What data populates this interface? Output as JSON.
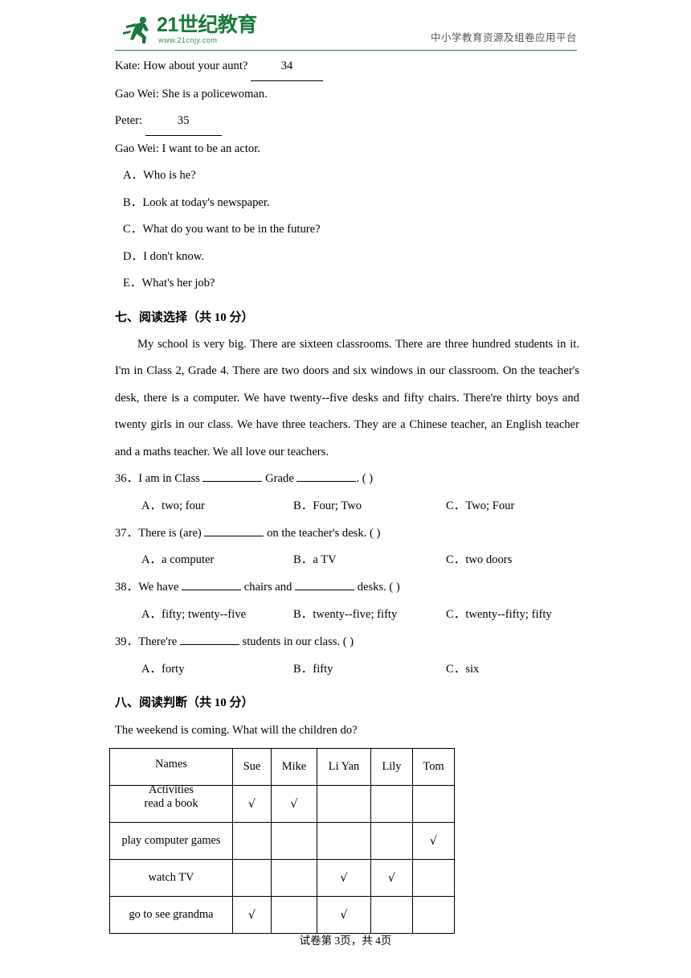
{
  "header": {
    "logo_text": "21世纪教育",
    "logo_url": "www.21cnjy.com",
    "slogan": "中小学教育资源及组卷应用平台"
  },
  "dialogue": {
    "lines": [
      {
        "speaker": "Kate: How about your aunt?",
        "blank": "34"
      },
      {
        "speaker": "Gao Wei: She is a policewoman.",
        "blank": ""
      },
      {
        "speaker": "Peter:",
        "blank": "35"
      },
      {
        "speaker": "Gao Wei: I want to be an actor.",
        "blank": ""
      }
    ],
    "choices": [
      "A．Who is he?",
      "B．Look at today's newspaper.",
      "C．What do you want to be in the future?",
      "D．I don't know.",
      "E．What's her job?"
    ]
  },
  "section7": {
    "title": "七、阅读选择（共 10 分）",
    "passage": "My school is very big. There are sixteen classrooms. There are three hundred students in it. I'm in Class 2, Grade 4. There are two doors and six windows in our classroom. On the teacher's desk, there is a computer. We have twenty--five desks and fifty chairs. There're thirty boys and twenty girls in our class. We have three teachers. They are a Chinese teacher, an English teacher and a maths teacher. We all love our teachers.",
    "questions": [
      {
        "number": "36．",
        "text_before": "I am in Class",
        "text_mid": "Grade",
        "text_after": ". (      )",
        "options": [
          "A．two; four",
          "B．Four; Two",
          "C．Two; Four"
        ]
      },
      {
        "number": "37．",
        "text_before": "There is (are)",
        "text_mid": "",
        "text_after": "on the teacher's desk. (      )",
        "options": [
          "A．a computer",
          "B．a TV",
          "C．two doors"
        ]
      },
      {
        "number": "38．",
        "text_before": "We have",
        "text_mid": "chairs and",
        "text_after": "desks. (      )",
        "options": [
          "A．fifty; twenty--five",
          "B．twenty--five; fifty",
          "C．twenty--fifty; fifty"
        ]
      },
      {
        "number": "39．",
        "text_before": "There're",
        "text_mid": "",
        "text_after": "students in our class. (      )",
        "options": [
          "A．forty",
          "B．fifty",
          "C．six"
        ]
      }
    ]
  },
  "section8": {
    "title": "八、阅读判断（共 10 分）",
    "intro": "The weekend is coming. What will the children do?",
    "table": {
      "corner_top": "Names",
      "corner_bottom": "Activities",
      "columns": [
        "Sue",
        "Mike",
        "Li Yan",
        "Lily",
        "Tom"
      ],
      "check_mark": "√",
      "rows": [
        {
          "activity": "read a book",
          "marks": [
            true,
            true,
            false,
            false,
            false
          ]
        },
        {
          "activity": "play computer games",
          "marks": [
            false,
            false,
            false,
            false,
            true
          ]
        },
        {
          "activity": "watch TV",
          "marks": [
            false,
            false,
            true,
            true,
            false
          ]
        },
        {
          "activity": "go to see grandma",
          "marks": [
            true,
            false,
            true,
            false,
            false
          ]
        }
      ]
    }
  },
  "footer": {
    "text": "试卷第 3页，共 4页"
  }
}
